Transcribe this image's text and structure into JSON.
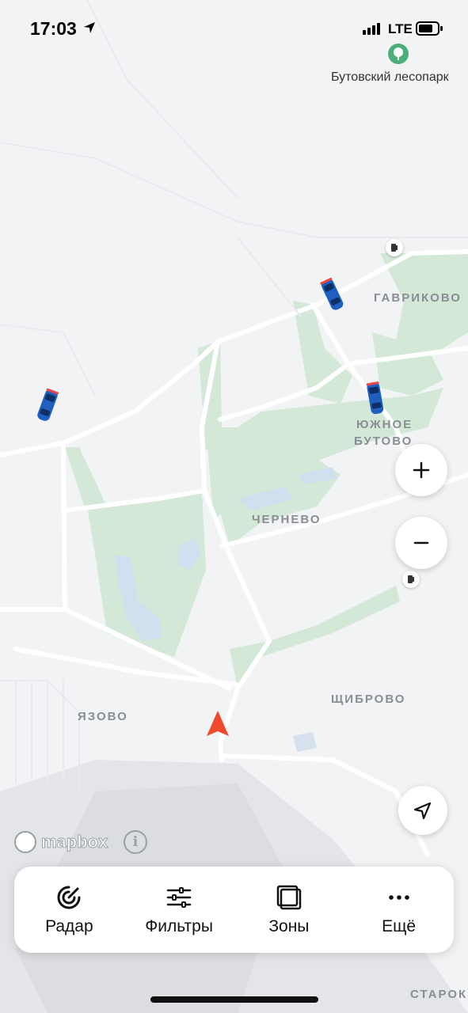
{
  "status_bar": {
    "time": "17:03",
    "network": "LTE"
  },
  "map": {
    "poi": {
      "park_label": "Бутовский лесопарк"
    },
    "places": {
      "gavrikovo": "ГАВРИКОВО",
      "yuzhnoe_butovo_line1": "ЮЖНОЕ",
      "yuzhnoe_butovo_line2": "БУТОВО",
      "chernevo": "ЧЕРНЕВО",
      "yazovo": "ЯЗОВО",
      "shchibrovo": "ЩИБРОВО",
      "starok": "СТАРОК"
    },
    "attribution": {
      "brand": "mapbox",
      "info": "i"
    }
  },
  "controls": {
    "zoom_in_icon": "plus-icon",
    "zoom_out_icon": "minus-icon",
    "locate_icon": "navigation-arrow-icon"
  },
  "toolbar": {
    "items": [
      {
        "label": "Радар",
        "icon": "radar-icon"
      },
      {
        "label": "Фильтры",
        "icon": "sliders-icon"
      },
      {
        "label": "Зоны",
        "icon": "zones-icon"
      },
      {
        "label": "Ещё",
        "icon": "more-dots-icon"
      }
    ]
  },
  "colors": {
    "accent_marker": "#f04a2e",
    "park_green": "#cfe6d3",
    "water": "#cfe0ee",
    "road": "#ffffff"
  }
}
